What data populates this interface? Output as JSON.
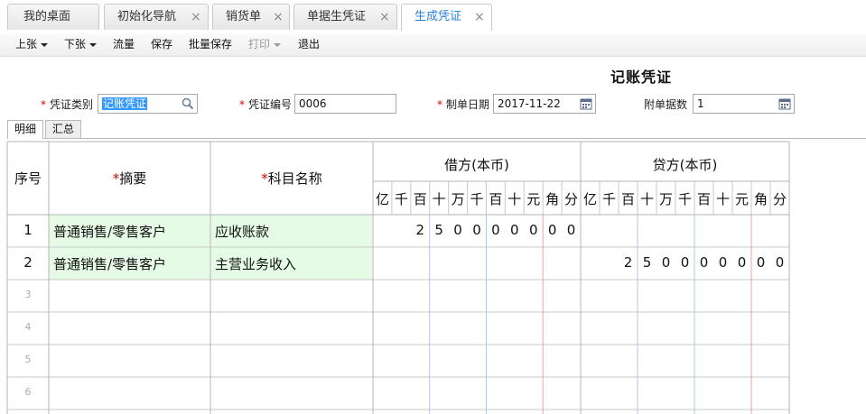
{
  "tabs": [
    {
      "label": "我的桌面",
      "closable": false,
      "active": false
    },
    {
      "label": "初始化导航",
      "closable": true,
      "active": false
    },
    {
      "label": "销货单",
      "closable": true,
      "active": false
    },
    {
      "label": "单据生凭证",
      "closable": true,
      "active": false
    },
    {
      "label": "生成凭证",
      "closable": true,
      "active": true
    }
  ],
  "close_glyph": "×",
  "toolbar": {
    "prev": "上张",
    "next": "下张",
    "flow": "流量",
    "save": "保存",
    "batch_save": "批量保存",
    "print": "打印",
    "exit": "退出"
  },
  "voucher": {
    "title": "记账凭证",
    "type_label": "凭证类别",
    "type_value": "记账凭证",
    "number_label": "凭证编号",
    "number_value": "0006",
    "date_label": "制单日期",
    "date_value": "2017-11-22",
    "attach_label": "附单据数",
    "attach_value": "1",
    "required_mark": "*"
  },
  "subtabs": [
    "明细",
    "汇总"
  ],
  "grid": {
    "col_seq": "序号",
    "col_summary": "摘要",
    "col_account": "科目名称",
    "col_debit": "借方(本币)",
    "col_credit": "贷方(本币)",
    "units": [
      "亿",
      "千",
      "百",
      "十",
      "万",
      "千",
      "百",
      "十",
      "元",
      "角",
      "分"
    ],
    "rows": [
      {
        "seq": "1",
        "summary": "普通销售/零售客户",
        "account": "应收账款",
        "debit": [
          "",
          "",
          "2",
          "5",
          "0",
          "0",
          "0",
          "0",
          "0",
          "0",
          "0"
        ],
        "credit": [
          "",
          "",
          "",
          "",
          "",
          "",
          "",
          "",
          "",
          "",
          ""
        ]
      },
      {
        "seq": "2",
        "summary": "普通销售/零售客户",
        "account": "主营业务收入",
        "debit": [
          "",
          "",
          "",
          "",
          "",
          "",
          "",
          "",
          "",
          "",
          ""
        ],
        "credit": [
          "",
          "",
          "2",
          "5",
          "0",
          "0",
          "0",
          "0",
          "0",
          "0",
          "0"
        ]
      },
      {
        "seq": "3",
        "summary": "",
        "account": ""
      },
      {
        "seq": "4",
        "summary": "",
        "account": ""
      },
      {
        "seq": "5",
        "summary": "",
        "account": ""
      },
      {
        "seq": "6",
        "summary": "",
        "account": ""
      }
    ]
  },
  "icons": {
    "type_field": "search-icon",
    "date_field": "calendar-icon",
    "attach_field": "calendar-icon"
  },
  "colors": {
    "active_tab_text": "#2a83d6",
    "required": "#d40000",
    "row_highlight": "#e6fbe6",
    "unit_separator": "#a9cbe8",
    "yuan_separator": "#f0a0a0",
    "selection": "#3399ff"
  }
}
